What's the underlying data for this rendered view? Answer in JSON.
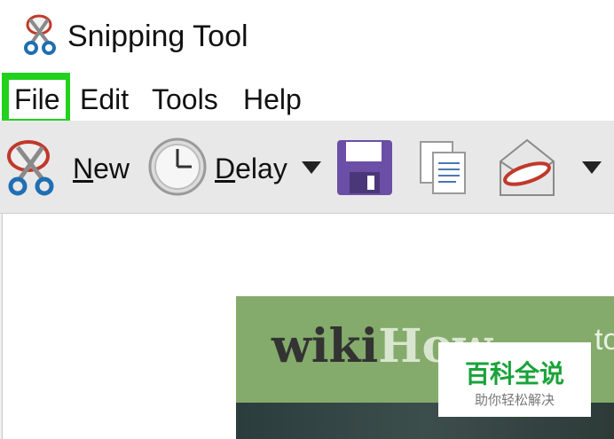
{
  "window": {
    "title": "Snipping Tool"
  },
  "menu": {
    "items": [
      {
        "label": "File",
        "highlighted": true
      },
      {
        "label": "Edit"
      },
      {
        "label": "Tools"
      },
      {
        "label": "Help"
      }
    ]
  },
  "toolbar": {
    "new_label_first": "N",
    "new_label_rest": "ew",
    "delay_label_first": "D",
    "delay_label_rest": "elay",
    "icons": [
      "scissors-icon",
      "clock-icon",
      "save-icon",
      "copy-icon",
      "email-icon",
      "dropdown-arrow-icon"
    ]
  },
  "capture": {
    "brand_part1": "wiki",
    "brand_part2": "How",
    "brand_tail": "to"
  },
  "watermark": {
    "main": "百科全说",
    "sub": "助你轻松解决"
  },
  "colors": {
    "highlight": "#22d11e",
    "capture_bg": "#84ab6b",
    "save_icon": "#6b4fa6",
    "watermark_text": "#1aa33a"
  }
}
